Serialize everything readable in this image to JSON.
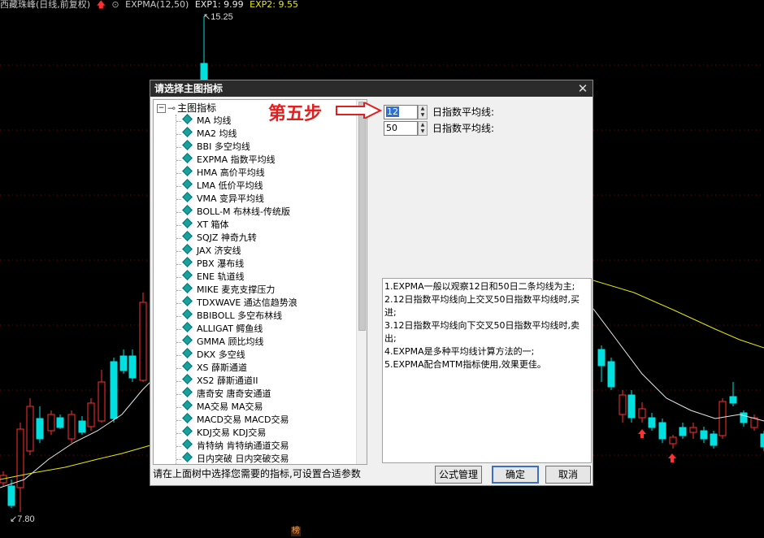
{
  "chart": {
    "title": "西藏珠峰(日线,前复权)",
    "indicator": "EXPMA(12,50)",
    "exp1_label": "EXP1: 9.99",
    "exp2_label": "EXP2: 9.55",
    "high_label": "15.25",
    "low_label": "7.80",
    "bottom_tag": "榜",
    "colors": {
      "up": "#ff3030",
      "down": "#00e0e0",
      "exp1": "#e8e8e8",
      "exp2": "#e8e800",
      "grid": "#800000"
    }
  },
  "dialog": {
    "title": "请选择主图指标",
    "close_glyph": "✕",
    "tree_root": "主图指标",
    "tree_items": [
      "MA 均线",
      "MA2 均线",
      "BBI 多空均线",
      "EXPMA 指数平均线",
      "HMA 高价平均线",
      "LMA 低价平均线",
      "VMA 变异平均线",
      "BOLL-M 布林线-传统版",
      "XT 箱体",
      "SQJZ 神奇九转",
      "JAX 济安线",
      "PBX 瀑布线",
      "ENE 轨道线",
      "MIKE 麦克支撑压力",
      "TDXWAVE 通达信趋势浪",
      "BBIBOLL 多空布林线",
      "ALLIGAT 鳄鱼线",
      "GMMA 顾比均线",
      "DKX 多空线",
      "XS 薛斯通道",
      "XS2 薛斯通道II",
      "唐奇安 唐奇安通道",
      "MA交易 MA交易",
      "MACD交易 MACD交易",
      "KDJ交易 KDJ交易",
      "肯特纳 肯特纳通道交易",
      "日内突破 日内突破交易"
    ],
    "params": [
      {
        "value": "12",
        "label": "日指数平均线:"
      },
      {
        "value": "50",
        "label": "日指数平均线:"
      }
    ],
    "description": [
      "1.EXPMA一般以观察12日和50日二条均线为主;",
      "2.12日指数平均线向上交叉50日指数平均线时,买进;",
      "3.12日指数平均线向下交叉50日指数平均线时,卖出;",
      "4.EXPMA是多种平均线计算方法的一;",
      "5.EXPMA配合MTM指标使用,效果更佳。"
    ],
    "status_text": "请在上面树中选择您需要的指标,可设置合适参数",
    "buttons": {
      "formula": "公式管理",
      "ok": "确定",
      "cancel": "取消"
    }
  },
  "annotation": {
    "text": "第五步"
  }
}
